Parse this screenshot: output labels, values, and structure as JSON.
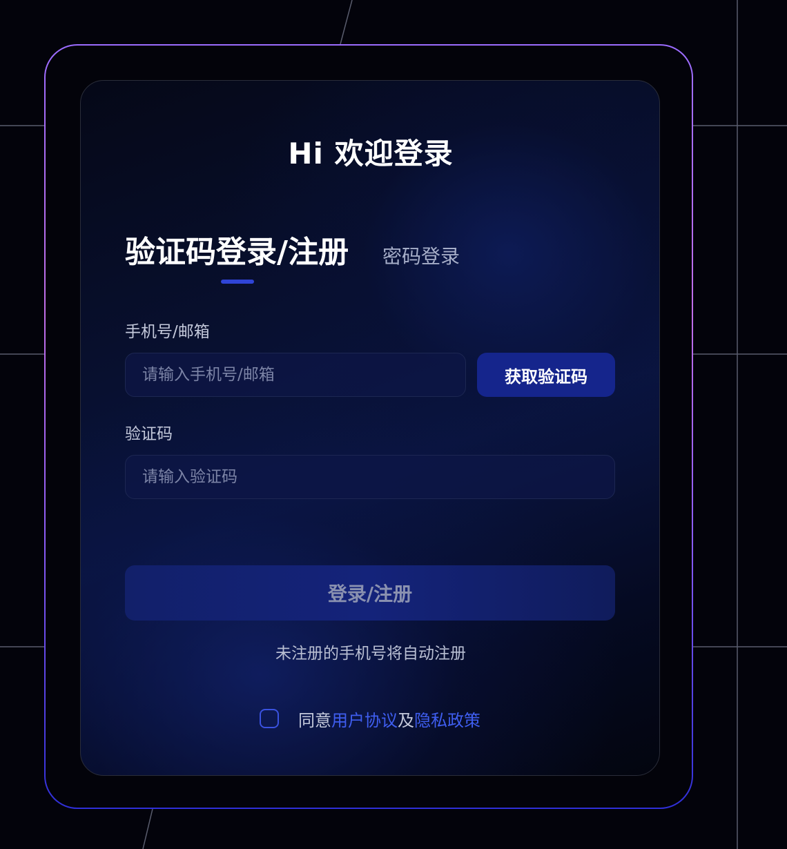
{
  "login": {
    "title": "Hi 欢迎登录",
    "tabs": {
      "active": "验证码登录/注册",
      "inactive": "密码登录"
    },
    "account": {
      "label": "手机号/邮箱",
      "placeholder": "请输入手机号/邮箱",
      "value": ""
    },
    "get_code_button": "获取验证码",
    "code": {
      "label": "验证码",
      "placeholder": "请输入验证码",
      "value": ""
    },
    "submit_button": "登录/注册",
    "hint": "未注册的手机号将自动注册",
    "agreement": {
      "checked": false,
      "prefix": "同意",
      "user_agreement": "用户协议",
      "conjunction": "及",
      "privacy_policy": "隐私政策"
    }
  },
  "colors": {
    "accent": "#2f44d6",
    "button": "#15258c",
    "link": "#3f5ef0",
    "frame_top": "#9b6cff",
    "frame_bottom": "#2f2fd8"
  }
}
